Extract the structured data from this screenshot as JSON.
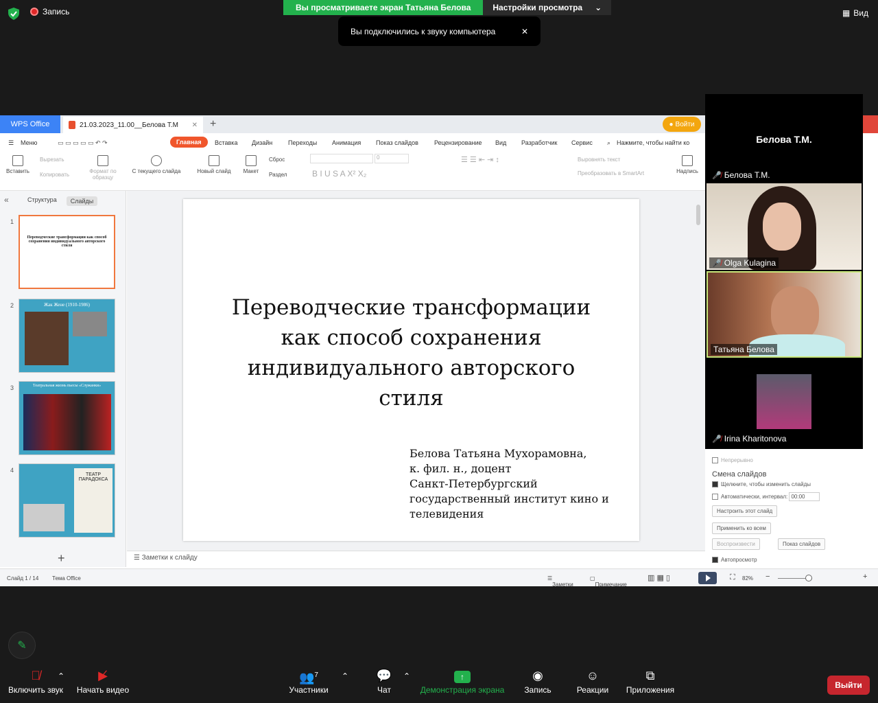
{
  "zoom": {
    "recording": "Запись",
    "share_banner": "Вы просматриваете экран Татьяна Белова",
    "view_settings": "Настройки просмотра",
    "view_label": "Вид",
    "toast": "Вы подключились к звуку компьютера",
    "participants": [
      {
        "name": "Белова Т.М.",
        "video": false
      },
      {
        "name": "Olga Kulagina",
        "video": true
      },
      {
        "name": "Татьяна Белова",
        "video": true
      },
      {
        "name": "Irina Kharitonova",
        "video": true
      }
    ],
    "participant_big_name": "Белова Т.М.",
    "controls": {
      "audio": "Включить звук",
      "video": "Начать видео",
      "participants": "Участники",
      "participants_count": "7",
      "chat": "Чат",
      "share": "Демонстрация экрана",
      "record": "Запись",
      "reactions": "Реакции",
      "apps": "Приложения",
      "leave": "Выйти"
    },
    "colors": {
      "green": "#23b14d",
      "red": "#c6262e"
    }
  },
  "wps": {
    "brand": "WPS Office",
    "doc_tab": "21.03.2023_11.00__Белова Т.М",
    "login": "Войти",
    "menu": [
      "Меню",
      "Главная",
      "Вставка",
      "Дизайн",
      "Переходы",
      "Анимация",
      "Показ слайдов",
      "Рецензирование",
      "Вид",
      "Разработчик",
      "Сервис"
    ],
    "search": "Нажмите, чтобы найти ко",
    "ribbon": {
      "paste": "Вставить",
      "cut": "Вырезать",
      "copy": "Копировать",
      "format": "Формат по образцу",
      "from_current": "С текущего слайда",
      "new_slide": "Новый слайд",
      "layout": "Макет",
      "reset": "Сброс",
      "section": "Раздел",
      "align_text": "Выровнять текст",
      "smartart": "Преобразовать в SmartArt",
      "textbox": "Надпись",
      "font_size": "0"
    },
    "panel_tabs": [
      "Структура",
      "Слайды"
    ],
    "slide": {
      "title": "Переводческие трансформации как способ сохранения индивидуального авторского стиля",
      "author": [
        "Белова Татьяна Мухорамовна,",
        "к. фил. н., доцент",
        "Санкт-Петербургский",
        "государственный институт кино и",
        "телевидения"
      ]
    },
    "thumbs": [
      {
        "num": "1",
        "title": "Переводческие трансформации как способ сохранения индивидуального авторского стиля"
      },
      {
        "num": "2",
        "title": "Жак Жене (1910-1986)"
      },
      {
        "num": "3",
        "title": "Театральная жизнь пьесы «Служанки»"
      },
      {
        "num": "4",
        "title": "ТЕАТР ПАРАДОКСА"
      }
    ],
    "notes": "Заметки к слайду",
    "status": {
      "slide": "Слайд 1 / 14",
      "theme": "Тема Office",
      "notes": "Заметки",
      "comment": "Примечание",
      "zoom": "82%"
    },
    "transition": {
      "continuous": "Непрерывно",
      "header": "Смена слайдов",
      "on_click": "Щелкните, чтобы изменить слайды",
      "auto": "Автоматически, интервал:",
      "interval": "00:00",
      "setup": "Настроить этот слайд",
      "apply_all": "Применить ко всем",
      "play": "Воспроизвести",
      "slideshow": "Показ слайдов",
      "autopreview": "Автопросмотр"
    }
  }
}
